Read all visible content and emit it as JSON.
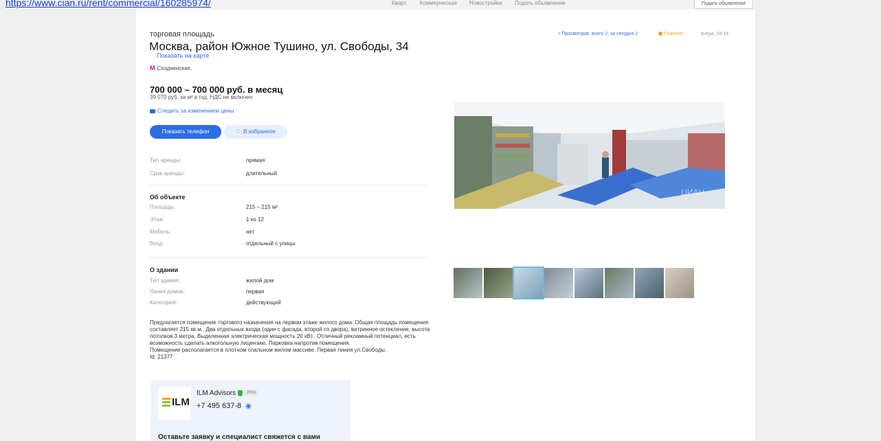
{
  "top": {
    "url_text": "https://www.cian.ru/rent/commercial/160285974/",
    "nav": [
      "Кварт.",
      "Коммерческая",
      "Новостройки",
      "Подать объявление"
    ],
    "right_button": "Подать объявление"
  },
  "listing": {
    "category": "торговая площадь",
    "address": "Москва, район Южное Тушино, ул. Свободы, 34",
    "map_link": "Показать на карте",
    "metro": "Сходненская,",
    "price": "700 000 – 700 000 руб. в месяц",
    "price_sub": "39 070 руб. за м² в год, НДС не включен",
    "follow_price": "Следить за изменением цены",
    "phone_button": "Показать телефон",
    "fav_button": "В избранное",
    "meta_views": "• Просмотров: всего 2, за сегодня 2",
    "meta_rating": "Платное",
    "meta_date": "вчера, 04:14"
  },
  "rent_terms": [
    {
      "k": "Тип аренды:",
      "v": "прямая"
    },
    {
      "k": "Срок аренды:",
      "v": "длительный"
    }
  ],
  "object": {
    "title": "Об объекте",
    "rows": [
      {
        "k": "Площадь:",
        "v": "215 – 215 м²"
      },
      {
        "k": "Этаж:",
        "v": "1 из 12"
      },
      {
        "k": "Мебель:",
        "v": "нет"
      },
      {
        "k": "Вход:",
        "v": "отдельный с улицы"
      }
    ]
  },
  "building": {
    "title": "О здании",
    "rows": [
      {
        "k": "Тип здания:",
        "v": "жилой дом"
      },
      {
        "k": "Линия домов:",
        "v": "первая"
      },
      {
        "k": "Категория:",
        "v": "действующий"
      }
    ]
  },
  "description": [
    "Предлагается помещение торгового назначения на первом этаже жилого дома. Общая площадь помещения составляет 215 кв.м.. Два отдельных входа (один с фасада, второй со двора), витринное остекление, высота потолков 3 метра. Выделенная электрическая мощность 20 кВт.. Отличный рекламный потенциал, есть возможность сделать алкогольную лицензию. Парковка напротив помещения.",
    "Помещение располагается в плотном спальном жилом массиве. Первая линия ул.Свободы.",
    "Id: 21377"
  ],
  "agent": {
    "logo_text": "ILM",
    "name": "ILM Advisors",
    "badge": "PRO",
    "phone": "+7 495 637-8",
    "cta": "Оставьте заявку и специалист свяжется с вами"
  },
  "photo": {
    "watermark": "ЦИАН"
  },
  "colors": {
    "accent": "#2b6de3",
    "metro": "#d4127a",
    "rating": "#f0a21f",
    "agent_bg": "#eef2fb"
  }
}
